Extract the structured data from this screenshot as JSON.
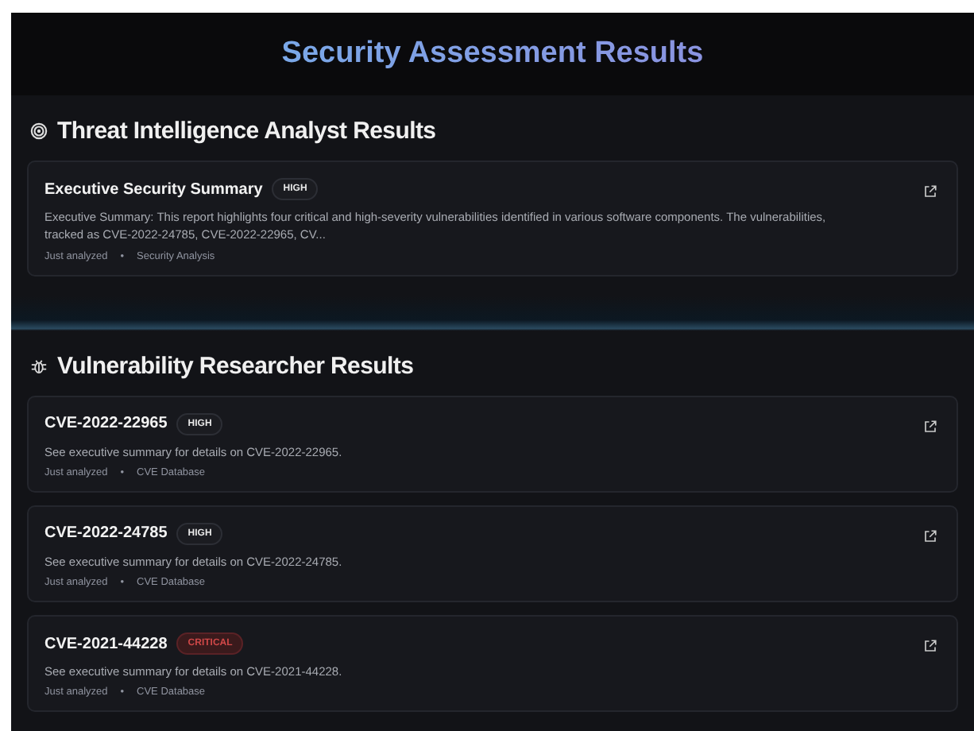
{
  "title": "Security Assessment Results",
  "sections": [
    {
      "heading": "Threat Intelligence Analyst Results",
      "kind": "target",
      "cards": [
        {
          "title": "Executive Security Summary",
          "severity": {
            "label": "HIGH",
            "kind": "high"
          },
          "description": "Executive Summary: This report highlights four critical and high-severity vulnerabilities identified in various software components. The vulnerabilities, tracked as CVE-2022-24785, CVE-2022-22965, CV...",
          "meta": {
            "time": "Just analyzed",
            "dot": "•",
            "source": "Security Analysis"
          }
        }
      ]
    },
    {
      "heading": "Vulnerability Researcher Results",
      "kind": "bug",
      "cards": [
        {
          "title": "CVE-2022-22965",
          "severity": {
            "label": "HIGH",
            "kind": "high"
          },
          "description": "See executive summary for details on CVE-2022-22965.",
          "meta": {
            "time": "Just analyzed",
            "dot": "•",
            "source": "CVE Database"
          }
        },
        {
          "title": "CVE-2022-24785",
          "severity": {
            "label": "HIGH",
            "kind": "high"
          },
          "description": "See executive summary for details on CVE-2022-24785.",
          "meta": {
            "time": "Just analyzed",
            "dot": "•",
            "source": "CVE Database"
          }
        },
        {
          "title": "CVE-2021-44228",
          "severity": {
            "label": "CRITICAL",
            "kind": "critical"
          },
          "description": "See executive summary for details on CVE-2021-44228.",
          "meta": {
            "time": "Just analyzed",
            "dot": "•",
            "source": "CVE Database"
          }
        }
      ]
    }
  ]
}
